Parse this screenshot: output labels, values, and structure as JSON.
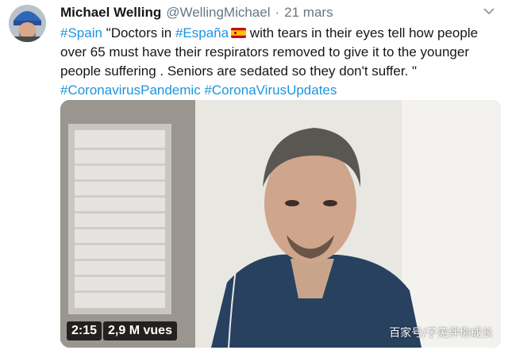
{
  "author": {
    "name": "Michael Welling",
    "handle": "@WellingMichael",
    "separator": "·",
    "date": "21 mars"
  },
  "tweet": {
    "hashtag_spain": "#Spain",
    "text_1": " \"Doctors in ",
    "hashtag_espana": "#España",
    "text_2": " with tears in their eyes tell how people over 65 must have their respirators removed to give it to the younger people suffering . Seniors are sedated so they don't suffer. \" ",
    "hashtag_pandemic": "#CoronavirusPandemic",
    "hashtag_updates": "#CoronaVirusUpdates"
  },
  "video": {
    "duration": "2:15",
    "views": "2,9 M vues",
    "watermark": "百家号/子羌伴你成长"
  },
  "colors": {
    "link": "#1b95e0",
    "text": "#14171a",
    "muted": "#657786"
  },
  "icons": {
    "caret": "chevron-down-icon",
    "flag": "spain-flag-icon"
  }
}
